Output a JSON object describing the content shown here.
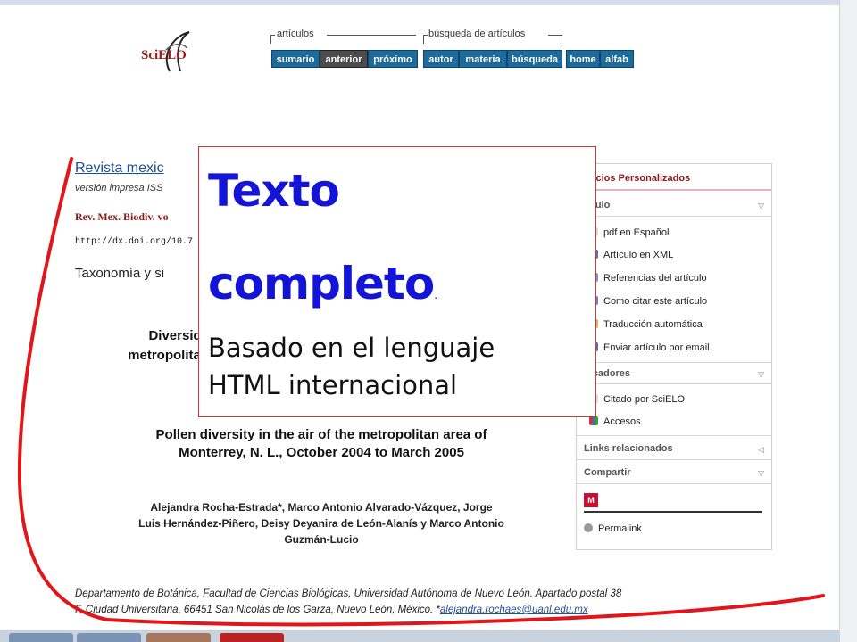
{
  "header": {
    "logo_text": "SciELO",
    "articles_group_label": "artículos",
    "search_group_label": "búsqueda de artículos",
    "nav_buttons": [
      "sumario",
      "anterior",
      "próximo",
      "autor",
      "materia",
      "búsqueda",
      "home",
      "alfab"
    ]
  },
  "article": {
    "journal_link": "Revista mexic",
    "version_text": "versión impresa ISS",
    "citation": "Rev. Mex. Biodiv. vo",
    "doi": "http://dx.doi.org/10.7",
    "section": "Taxonomía y si",
    "title_es_line1": "Diversida",
    "title_es_line2": "metropolitan",
    "title_en_line1": "Pollen diversity in the air of the metropolitan area of",
    "title_en_line2": "Monterrey, N. L., October 2004 to March 2005",
    "authors_line1": "Alejandra Rocha-Estrada*, Marco Antonio Alvarado-Vázquez, Jorge",
    "authors_line2": "Luis Hernández-Piñero, Deisy Deyanira de León-Alanís y Marco Antonio",
    "authors_line3": "Guzmán-Lucio",
    "affiliation_line1": "Departamento de Botánica, Facultad de Ciencias Biológicas, Universidad Autónoma de Nuevo León. Apartado postal 38",
    "affiliation_line2": "F, Ciudad Universitaria, 66451 San Nicolás de los Garza, Nuevo León, México. *",
    "email": "alejandra.rochaes@uanl.edu.mx"
  },
  "sidebar": {
    "title": "rvicios Personalizados",
    "section_article": "tículo",
    "article_items": [
      "pdf en Español",
      "Artículo en XML",
      "Referencias del artículo",
      "Como citar este artículo",
      "Traducción automática",
      "Enviar artículo por email"
    ],
    "section_indicators": "dicadores",
    "indicator_items": [
      "Citado por SciELO",
      "Accesos"
    ],
    "section_links": "Links relacionados",
    "section_share": "Compartir",
    "permalink": "Permalink"
  },
  "overlay": {
    "title_line1": "Texto",
    "title_line2": "completo",
    "title_dot": ".",
    "subtitle_line1": "Basado en el lenguaje",
    "subtitle_line2": "HTML internacional"
  },
  "colors": {
    "overlay_title": "#1414d6",
    "marker": "#e0161b",
    "nav_button": "#1d6b9c",
    "sidebar_title": "#8b1a1a"
  }
}
